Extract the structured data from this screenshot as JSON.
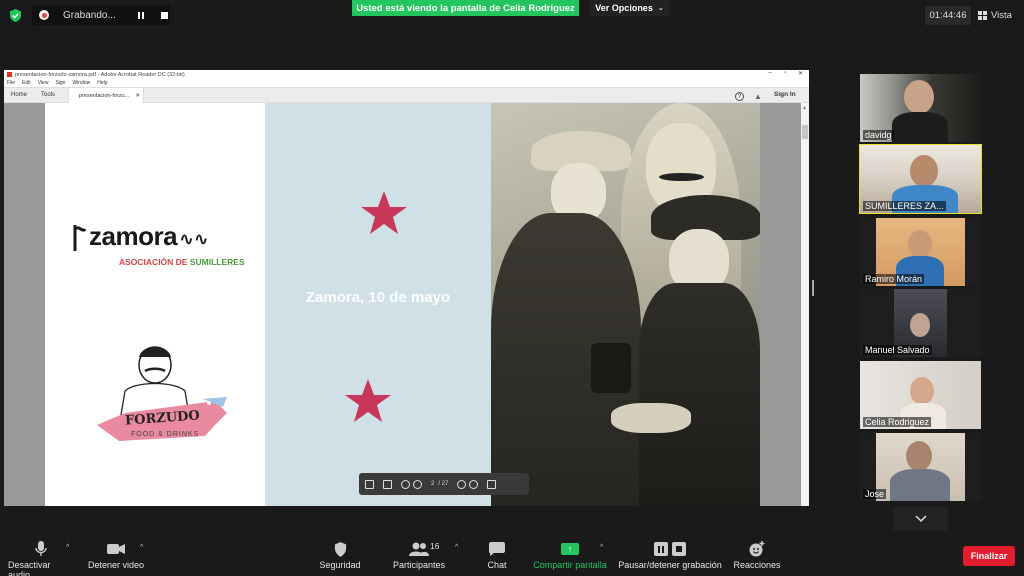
{
  "topbar": {
    "recording_label": "Grabando...",
    "banner": "Usted está viendo la pantalla de Celia Rodriguez",
    "view_options": "Ver Opciones",
    "clock": "01:44:46",
    "view_label": "Vista"
  },
  "acrobat": {
    "title": "presentacion-forzudo-zamora.pdf - Adobe Acrobat Reader DC (32-bit)",
    "menu": [
      "File",
      "Edit",
      "View",
      "Sign",
      "Window",
      "Help"
    ],
    "tab_home": "Home",
    "tab_tools": "Tools",
    "tab_doc": "presentacion-forzu...",
    "sign_in": "Sign In",
    "page_current": "2",
    "page_total": "/ 27"
  },
  "slide": {
    "logo_text": "zamora",
    "logo_sub_a": "ASOCIACIÓN DE",
    "logo_sub_b": "SUMILLERES",
    "forzudo_name": "FORZUDO",
    "forzudo_sub": "FOOD & DRINKS",
    "date_text": "Zamora, 10 de mayo",
    "star_color": "#c8375a"
  },
  "participants": [
    {
      "name": "davidg"
    },
    {
      "name": "SUMILLERES ZA..."
    },
    {
      "name": "Ramiro Morán"
    },
    {
      "name": "Manuel Salvado"
    },
    {
      "name": "Celia Rodriguez"
    },
    {
      "name": "Jose"
    }
  ],
  "toolbar": {
    "mute": "Desactivar audio",
    "video": "Detener video",
    "security": "Seguridad",
    "participants": "Participantes",
    "participants_count": "16",
    "chat": "Chat",
    "share": "Compartir pantalla",
    "record": "Pausar/detener grabación",
    "reactions": "Reacciones",
    "end": "Finalizar"
  },
  "colors": {
    "accent_green": "#22c55e",
    "end_red": "#e11d2e",
    "active_border": "#e5e02a"
  }
}
